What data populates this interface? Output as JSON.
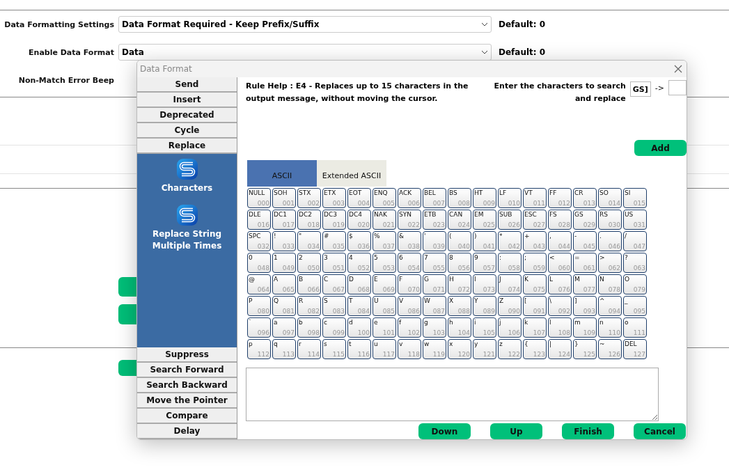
{
  "settings": [
    {
      "label": "Data Formatting Settings",
      "value": "Data Format Required - Keep Prefix/Suffix",
      "default": "Default: 0"
    },
    {
      "label": "Enable Data Format",
      "value": "Data",
      "default": "Default: 0"
    },
    {
      "label": "Non-Match Error Beep"
    }
  ],
  "dialog": {
    "title": "Data Format",
    "categories": [
      {
        "label": "Send",
        "expanded": false
      },
      {
        "label": "Insert",
        "expanded": false
      },
      {
        "label": "Deprecated",
        "expanded": false
      },
      {
        "label": "Cycle",
        "expanded": false
      },
      {
        "label": "Replace",
        "expanded": true,
        "items": [
          {
            "label": "Characters"
          },
          {
            "label": "Replace String Multiple Times"
          }
        ]
      },
      {
        "label": "Suppress",
        "expanded": false
      },
      {
        "label": "Search Forward",
        "expanded": false
      },
      {
        "label": "Search Backward",
        "expanded": false
      },
      {
        "label": "Move the Pointer",
        "expanded": false
      },
      {
        "label": "Compare",
        "expanded": false
      },
      {
        "label": "Delay",
        "expanded": false
      }
    ],
    "rule_help": "Rule Help : E4 - Replaces up to 15 characters in the output message, without moving the cursor.",
    "search_label": "Enter the characters to search and replace",
    "search_value": "GS]",
    "arrow": "->",
    "add_button": "Add",
    "tabs": [
      {
        "label": "ASCII",
        "selected": true
      },
      {
        "label": "Extended ASCII",
        "selected": false
      }
    ],
    "keys": [
      {
        "label": "NULL",
        "code": "000"
      },
      {
        "label": "SOH",
        "code": "001"
      },
      {
        "label": "STX",
        "code": "002"
      },
      {
        "label": "ETX",
        "code": "003"
      },
      {
        "label": "EOT",
        "code": "004"
      },
      {
        "label": "ENQ",
        "code": "005"
      },
      {
        "label": "ACK",
        "code": "006"
      },
      {
        "label": "BEL",
        "code": "007"
      },
      {
        "label": "BS",
        "code": "008"
      },
      {
        "label": "HT",
        "code": "009"
      },
      {
        "label": "LF",
        "code": "010"
      },
      {
        "label": "VT",
        "code": "011"
      },
      {
        "label": "FF",
        "code": "012"
      },
      {
        "label": "CR",
        "code": "013"
      },
      {
        "label": "SO",
        "code": "014"
      },
      {
        "label": "SI",
        "code": "015"
      },
      {
        "label": "DLE",
        "code": "016"
      },
      {
        "label": "DC1",
        "code": "017"
      },
      {
        "label": "DC2",
        "code": "018"
      },
      {
        "label": "DC3",
        "code": "019"
      },
      {
        "label": "DC4",
        "code": "020"
      },
      {
        "label": "NAK",
        "code": "021"
      },
      {
        "label": "SYN",
        "code": "022"
      },
      {
        "label": "ETB",
        "code": "023"
      },
      {
        "label": "CAN",
        "code": "024"
      },
      {
        "label": "EM",
        "code": "025"
      },
      {
        "label": "SUB",
        "code": "026"
      },
      {
        "label": "ESC",
        "code": "027"
      },
      {
        "label": "FS",
        "code": "028"
      },
      {
        "label": "GS",
        "code": "029"
      },
      {
        "label": "RS",
        "code": "030"
      },
      {
        "label": "US",
        "code": "031"
      },
      {
        "label": "SPC",
        "code": "032"
      },
      {
        "label": "!",
        "code": "033"
      },
      {
        "label": "\"",
        "code": "034"
      },
      {
        "label": "#",
        "code": "035"
      },
      {
        "label": "$",
        "code": "036"
      },
      {
        "label": "%",
        "code": "037"
      },
      {
        "label": "&",
        "code": "038"
      },
      {
        "label": "'",
        "code": "039"
      },
      {
        "label": "(",
        "code": "040"
      },
      {
        "label": ")",
        "code": "041"
      },
      {
        "label": "*",
        "code": "042"
      },
      {
        "label": "+",
        "code": "043"
      },
      {
        "label": ",",
        "code": "044"
      },
      {
        "label": "-",
        "code": "045"
      },
      {
        "label": ".",
        "code": "046"
      },
      {
        "label": "/",
        "code": "047"
      },
      {
        "label": "0",
        "code": "048"
      },
      {
        "label": "1",
        "code": "049"
      },
      {
        "label": "2",
        "code": "050"
      },
      {
        "label": "3",
        "code": "051"
      },
      {
        "label": "4",
        "code": "052"
      },
      {
        "label": "5",
        "code": "053"
      },
      {
        "label": "6",
        "code": "054"
      },
      {
        "label": "7",
        "code": "055"
      },
      {
        "label": "8",
        "code": "056"
      },
      {
        "label": "9",
        "code": "057"
      },
      {
        "label": ":",
        "code": "058"
      },
      {
        "label": ";",
        "code": "059"
      },
      {
        "label": "<",
        "code": "060"
      },
      {
        "label": "=",
        "code": "061"
      },
      {
        "label": ">",
        "code": "062"
      },
      {
        "label": "?",
        "code": "063"
      },
      {
        "label": "@",
        "code": "064"
      },
      {
        "label": "A",
        "code": "065"
      },
      {
        "label": "B",
        "code": "066"
      },
      {
        "label": "C",
        "code": "067"
      },
      {
        "label": "D",
        "code": "068"
      },
      {
        "label": "E",
        "code": "069"
      },
      {
        "label": "F",
        "code": "070"
      },
      {
        "label": "G",
        "code": "071"
      },
      {
        "label": "H",
        "code": "072"
      },
      {
        "label": "I",
        "code": "073"
      },
      {
        "label": "J",
        "code": "074"
      },
      {
        "label": "K",
        "code": "075"
      },
      {
        "label": "L",
        "code": "076"
      },
      {
        "label": "M",
        "code": "077"
      },
      {
        "label": "N",
        "code": "078"
      },
      {
        "label": "O",
        "code": "079"
      },
      {
        "label": "P",
        "code": "080"
      },
      {
        "label": "Q",
        "code": "081"
      },
      {
        "label": "R",
        "code": "082"
      },
      {
        "label": "S",
        "code": "083"
      },
      {
        "label": "T",
        "code": "084"
      },
      {
        "label": "U",
        "code": "085"
      },
      {
        "label": "V",
        "code": "086"
      },
      {
        "label": "W",
        "code": "087"
      },
      {
        "label": "X",
        "code": "088"
      },
      {
        "label": "Y",
        "code": "089"
      },
      {
        "label": "Z",
        "code": "090"
      },
      {
        "label": "[",
        "code": "091"
      },
      {
        "label": "\\",
        "code": "092"
      },
      {
        "label": "]",
        "code": "093"
      },
      {
        "label": "^",
        "code": "094"
      },
      {
        "label": "_",
        "code": "095"
      },
      {
        "label": "`",
        "code": "096"
      },
      {
        "label": "a",
        "code": "097"
      },
      {
        "label": "b",
        "code": "098"
      },
      {
        "label": "c",
        "code": "099"
      },
      {
        "label": "d",
        "code": "100"
      },
      {
        "label": "e",
        "code": "101"
      },
      {
        "label": "f",
        "code": "102"
      },
      {
        "label": "g",
        "code": "103"
      },
      {
        "label": "h",
        "code": "104"
      },
      {
        "label": "i",
        "code": "105"
      },
      {
        "label": "j",
        "code": "106"
      },
      {
        "label": "k",
        "code": "107"
      },
      {
        "label": "l",
        "code": "108"
      },
      {
        "label": "m",
        "code": "109"
      },
      {
        "label": "n",
        "code": "110"
      },
      {
        "label": "o",
        "code": "111"
      },
      {
        "label": "p",
        "code": "112"
      },
      {
        "label": "q",
        "code": "113"
      },
      {
        "label": "r",
        "code": "114"
      },
      {
        "label": "s",
        "code": "115"
      },
      {
        "label": "t",
        "code": "116"
      },
      {
        "label": "u",
        "code": "117"
      },
      {
        "label": "v",
        "code": "118"
      },
      {
        "label": "w",
        "code": "119"
      },
      {
        "label": "x",
        "code": "120"
      },
      {
        "label": "y",
        "code": "121"
      },
      {
        "label": "z",
        "code": "122"
      },
      {
        "label": "{",
        "code": "123"
      },
      {
        "label": "|",
        "code": "124"
      },
      {
        "label": "}",
        "code": "125"
      },
      {
        "label": "~",
        "code": "126"
      },
      {
        "label": "DEL",
        "code": "127"
      }
    ],
    "buttons": [
      "Down",
      "Up",
      "Finish",
      "Cancel"
    ]
  }
}
